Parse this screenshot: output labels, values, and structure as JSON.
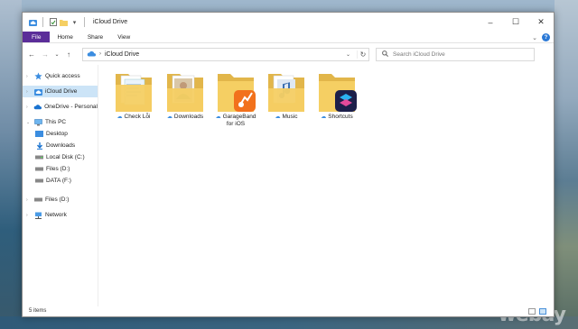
{
  "window": {
    "title": "iCloud Drive"
  },
  "ribbon": {
    "tabs": [
      "File",
      "Home",
      "Share",
      "View"
    ]
  },
  "navbar": {
    "path": "iCloud Drive",
    "search_placeholder": "Search iCloud Drive"
  },
  "sidebar": {
    "items": [
      {
        "label": "Quick access",
        "icon": "star-icon"
      },
      {
        "label": "iCloud Drive",
        "icon": "cloud-icon"
      },
      {
        "label": "OneDrive - Personal",
        "icon": "onedrive-icon"
      },
      {
        "label": "This PC",
        "icon": "pc-icon"
      },
      {
        "label": "Desktop",
        "icon": "desktop-icon"
      },
      {
        "label": "Downloads",
        "icon": "download-icon"
      },
      {
        "label": "Local Disk (C:)",
        "icon": "drive-icon"
      },
      {
        "label": "Files (D:)",
        "icon": "drive-icon"
      },
      {
        "label": "DATA (F:)",
        "icon": "drive-icon"
      },
      {
        "label": "Files (D:)",
        "icon": "drive-icon"
      },
      {
        "label": "Network",
        "icon": "network-icon"
      }
    ]
  },
  "folders": [
    {
      "name": "Check Lỗi",
      "name2": ""
    },
    {
      "name": "Downloads",
      "name2": ""
    },
    {
      "name": "GarageBand",
      "name2": "for iOS"
    },
    {
      "name": "Music",
      "name2": ""
    },
    {
      "name": "Shortcuts",
      "name2": ""
    }
  ],
  "status": {
    "items": "5 items"
  },
  "watermark": "webay",
  "colors": {
    "file_tab": "#5b2d99",
    "selection": "#cce4f7",
    "folder": "#f5cf63",
    "cloud_accent": "#3b8de0"
  }
}
